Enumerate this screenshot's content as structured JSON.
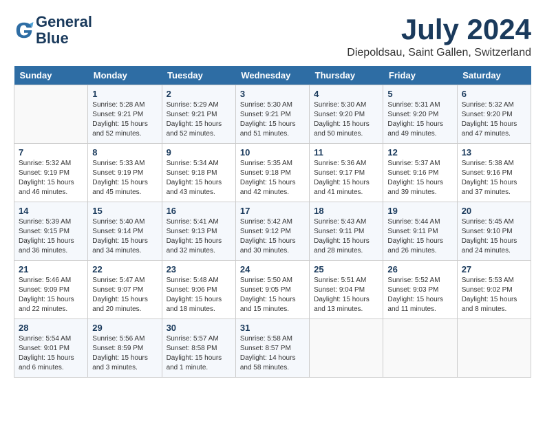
{
  "header": {
    "logo_line1": "General",
    "logo_line2": "Blue",
    "month_title": "July 2024",
    "location": "Diepoldsau, Saint Gallen, Switzerland"
  },
  "days_of_week": [
    "Sunday",
    "Monday",
    "Tuesday",
    "Wednesday",
    "Thursday",
    "Friday",
    "Saturday"
  ],
  "weeks": [
    [
      {
        "day": "",
        "info": ""
      },
      {
        "day": "1",
        "info": "Sunrise: 5:28 AM\nSunset: 9:21 PM\nDaylight: 15 hours\nand 52 minutes."
      },
      {
        "day": "2",
        "info": "Sunrise: 5:29 AM\nSunset: 9:21 PM\nDaylight: 15 hours\nand 52 minutes."
      },
      {
        "day": "3",
        "info": "Sunrise: 5:30 AM\nSunset: 9:21 PM\nDaylight: 15 hours\nand 51 minutes."
      },
      {
        "day": "4",
        "info": "Sunrise: 5:30 AM\nSunset: 9:20 PM\nDaylight: 15 hours\nand 50 minutes."
      },
      {
        "day": "5",
        "info": "Sunrise: 5:31 AM\nSunset: 9:20 PM\nDaylight: 15 hours\nand 49 minutes."
      },
      {
        "day": "6",
        "info": "Sunrise: 5:32 AM\nSunset: 9:20 PM\nDaylight: 15 hours\nand 47 minutes."
      }
    ],
    [
      {
        "day": "7",
        "info": "Sunrise: 5:32 AM\nSunset: 9:19 PM\nDaylight: 15 hours\nand 46 minutes."
      },
      {
        "day": "8",
        "info": "Sunrise: 5:33 AM\nSunset: 9:19 PM\nDaylight: 15 hours\nand 45 minutes."
      },
      {
        "day": "9",
        "info": "Sunrise: 5:34 AM\nSunset: 9:18 PM\nDaylight: 15 hours\nand 43 minutes."
      },
      {
        "day": "10",
        "info": "Sunrise: 5:35 AM\nSunset: 9:18 PM\nDaylight: 15 hours\nand 42 minutes."
      },
      {
        "day": "11",
        "info": "Sunrise: 5:36 AM\nSunset: 9:17 PM\nDaylight: 15 hours\nand 41 minutes."
      },
      {
        "day": "12",
        "info": "Sunrise: 5:37 AM\nSunset: 9:16 PM\nDaylight: 15 hours\nand 39 minutes."
      },
      {
        "day": "13",
        "info": "Sunrise: 5:38 AM\nSunset: 9:16 PM\nDaylight: 15 hours\nand 37 minutes."
      }
    ],
    [
      {
        "day": "14",
        "info": "Sunrise: 5:39 AM\nSunset: 9:15 PM\nDaylight: 15 hours\nand 36 minutes."
      },
      {
        "day": "15",
        "info": "Sunrise: 5:40 AM\nSunset: 9:14 PM\nDaylight: 15 hours\nand 34 minutes."
      },
      {
        "day": "16",
        "info": "Sunrise: 5:41 AM\nSunset: 9:13 PM\nDaylight: 15 hours\nand 32 minutes."
      },
      {
        "day": "17",
        "info": "Sunrise: 5:42 AM\nSunset: 9:12 PM\nDaylight: 15 hours\nand 30 minutes."
      },
      {
        "day": "18",
        "info": "Sunrise: 5:43 AM\nSunset: 9:11 PM\nDaylight: 15 hours\nand 28 minutes."
      },
      {
        "day": "19",
        "info": "Sunrise: 5:44 AM\nSunset: 9:11 PM\nDaylight: 15 hours\nand 26 minutes."
      },
      {
        "day": "20",
        "info": "Sunrise: 5:45 AM\nSunset: 9:10 PM\nDaylight: 15 hours\nand 24 minutes."
      }
    ],
    [
      {
        "day": "21",
        "info": "Sunrise: 5:46 AM\nSunset: 9:09 PM\nDaylight: 15 hours\nand 22 minutes."
      },
      {
        "day": "22",
        "info": "Sunrise: 5:47 AM\nSunset: 9:07 PM\nDaylight: 15 hours\nand 20 minutes."
      },
      {
        "day": "23",
        "info": "Sunrise: 5:48 AM\nSunset: 9:06 PM\nDaylight: 15 hours\nand 18 minutes."
      },
      {
        "day": "24",
        "info": "Sunrise: 5:50 AM\nSunset: 9:05 PM\nDaylight: 15 hours\nand 15 minutes."
      },
      {
        "day": "25",
        "info": "Sunrise: 5:51 AM\nSunset: 9:04 PM\nDaylight: 15 hours\nand 13 minutes."
      },
      {
        "day": "26",
        "info": "Sunrise: 5:52 AM\nSunset: 9:03 PM\nDaylight: 15 hours\nand 11 minutes."
      },
      {
        "day": "27",
        "info": "Sunrise: 5:53 AM\nSunset: 9:02 PM\nDaylight: 15 hours\nand 8 minutes."
      }
    ],
    [
      {
        "day": "28",
        "info": "Sunrise: 5:54 AM\nSunset: 9:01 PM\nDaylight: 15 hours\nand 6 minutes."
      },
      {
        "day": "29",
        "info": "Sunrise: 5:56 AM\nSunset: 8:59 PM\nDaylight: 15 hours\nand 3 minutes."
      },
      {
        "day": "30",
        "info": "Sunrise: 5:57 AM\nSunset: 8:58 PM\nDaylight: 15 hours\nand 1 minute."
      },
      {
        "day": "31",
        "info": "Sunrise: 5:58 AM\nSunset: 8:57 PM\nDaylight: 14 hours\nand 58 minutes."
      },
      {
        "day": "",
        "info": ""
      },
      {
        "day": "",
        "info": ""
      },
      {
        "day": "",
        "info": ""
      }
    ]
  ]
}
